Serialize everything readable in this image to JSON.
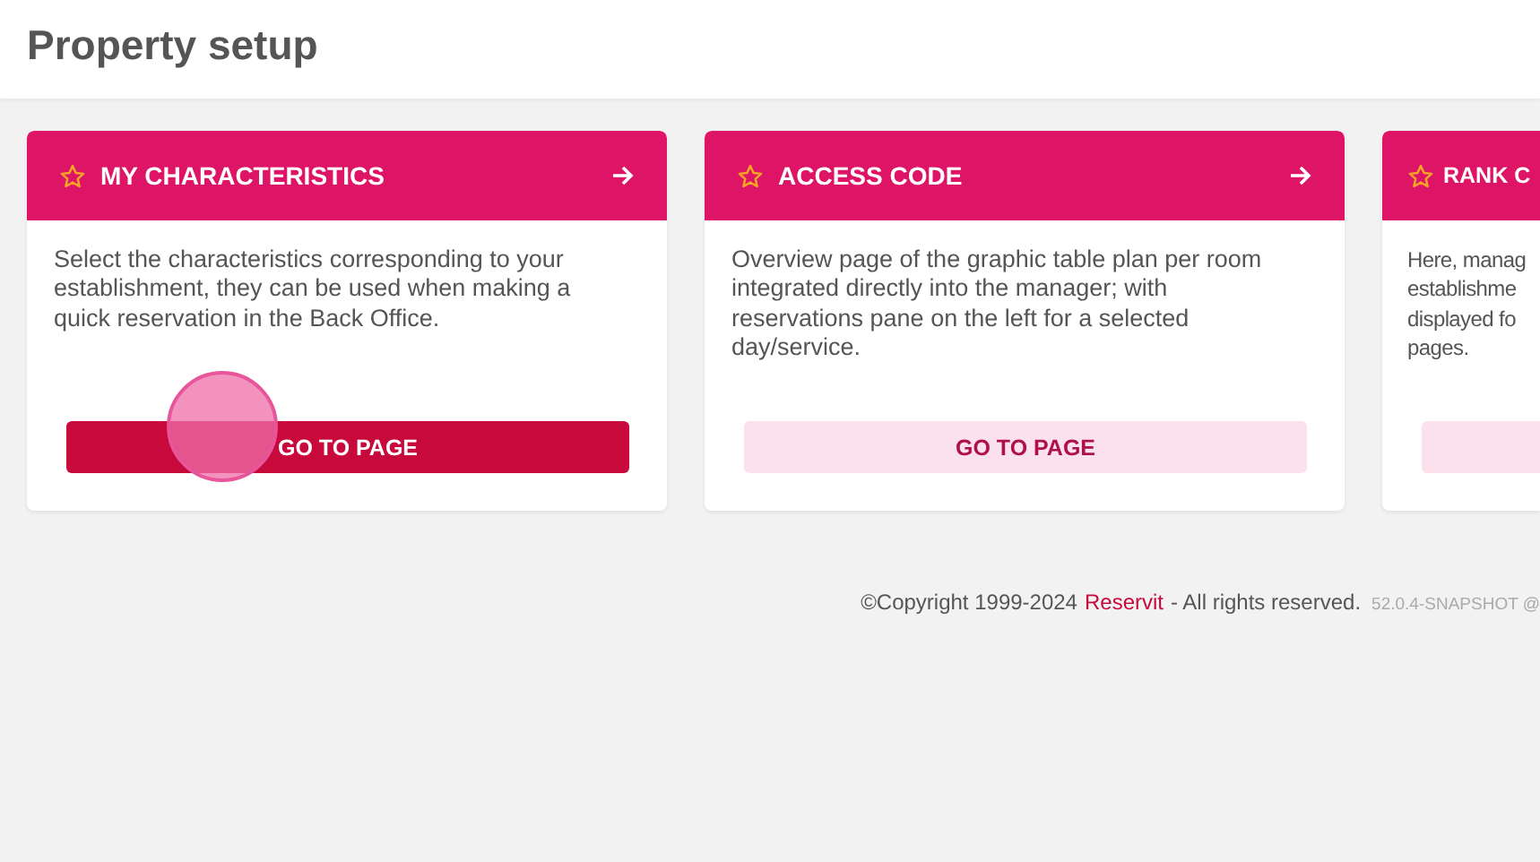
{
  "page_title": "Property setup",
  "cards": [
    {
      "title": "MY CHARACTERISTICS",
      "arrow": true,
      "lines": [
        "Select the characteristics corresponding to your",
        "establishment, they can be used when making a",
        "quick reservation in the Back Office."
      ],
      "button": {
        "label": "GO TO PAGE",
        "pressed": true
      },
      "touch_indicator": true
    },
    {
      "title": "ACCESS CODE",
      "arrow": true,
      "lines": [
        "Overview page of the graphic table plan per room",
        "integrated directly into the manager; with",
        "reservations pane on the left for a selected",
        "day/service."
      ],
      "button": {
        "label": "GO TO PAGE",
        "pressed": false
      },
      "touch_indicator": false
    },
    {
      "title": "RANK C",
      "lines": [
        "Here, manag",
        "establishme",
        "displayed fo",
        "pages."
      ],
      "button": {
        "pressed": false
      },
      "touch_indicator": false
    }
  ],
  "footer": {
    "copyright": "©Copyright 1999-2024",
    "brand_link": "Reservit",
    "rights": "- All rights reserved.",
    "version": "52.0.4-SNAPSHOT @"
  }
}
